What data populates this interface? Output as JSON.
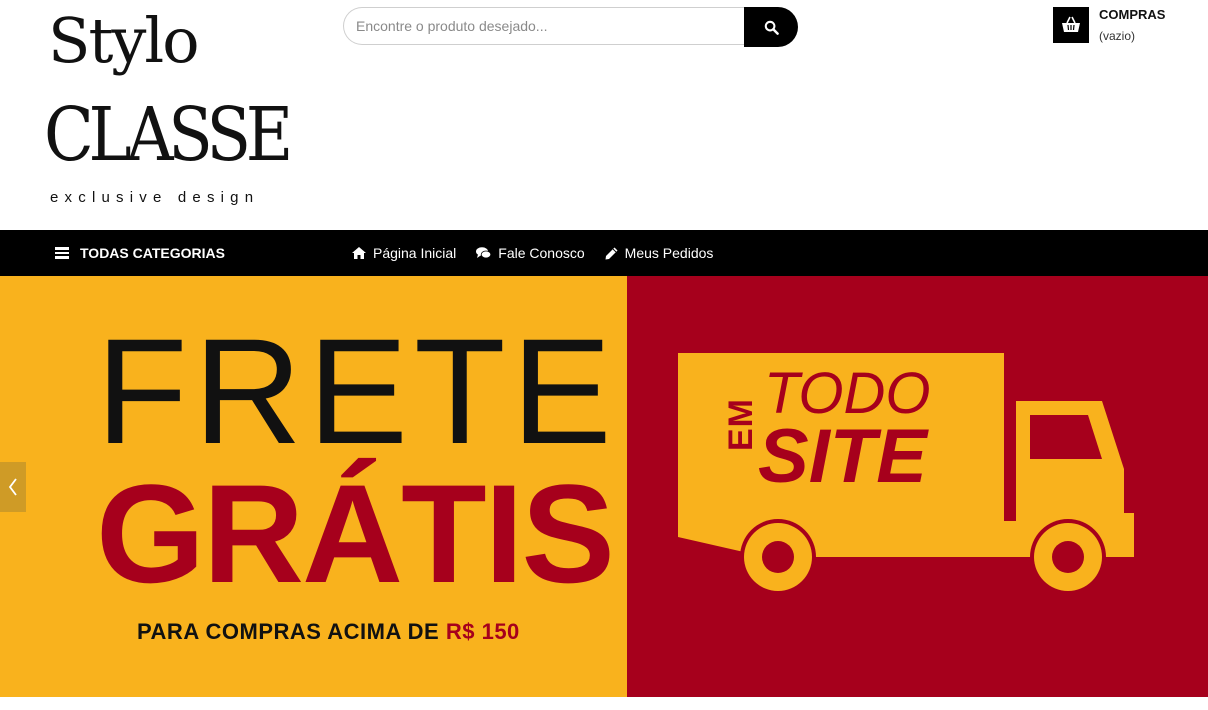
{
  "brand": {
    "line1": "Stylo",
    "line2": "CLASSE",
    "tagline": "exclusive design"
  },
  "search": {
    "placeholder": "Encontre o produto desejado...",
    "button_icon": "search-icon"
  },
  "cart": {
    "title": "COMPRAS",
    "status": "(vazio)",
    "icon": "basket-icon"
  },
  "nav": {
    "categories_label": "TODAS CATEGORIAS",
    "links": [
      {
        "label": "Página Inicial",
        "icon": "home-icon"
      },
      {
        "label": "Fale Conosco",
        "icon": "chat-icon"
      },
      {
        "label": "Meus Pedidos",
        "icon": "pencil-icon"
      }
    ]
  },
  "banner": {
    "line1": "FRETE",
    "line2": "GRÁTIS",
    "subtitle_prefix": "PARA COMPRAS ACIMA DE",
    "subtitle_price": "R$ 150",
    "truck_em": "EM",
    "truck_todo": "TODO",
    "truck_site": "SITE",
    "colors": {
      "yellow": "#f9b21d",
      "red": "#a6001c",
      "dark": "#111111"
    }
  },
  "slider": {
    "prev_icon": "chevron-left-icon"
  }
}
